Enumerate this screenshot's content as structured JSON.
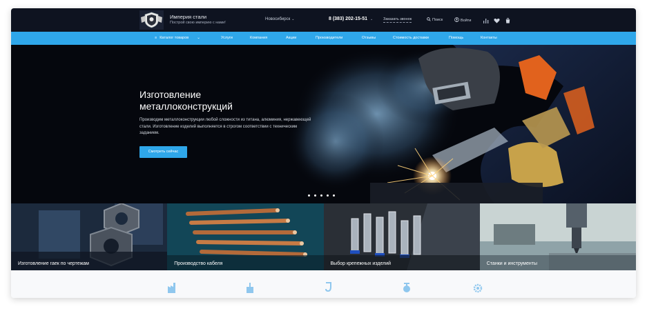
{
  "header": {
    "brand_name": "Империя стали",
    "brand_slogan": "Построй свою империю с нами!",
    "city": "Новосибирск",
    "phone": "8 (383) 202-15-51",
    "callback_link": "Заказать звонок",
    "search_label": "Поиск",
    "login_label": "Войти"
  },
  "nav": {
    "catalog_label": "Каталог товаров",
    "items": [
      "Услуги",
      "Компания",
      "Акции",
      "Производители",
      "Отзывы",
      "Стоимость доставки",
      "Помощь",
      "Контакты"
    ]
  },
  "hero": {
    "title": "Изготовление металлоконструкций",
    "text": "Производим металлоконструкции любой сложности из титана, алюминия, нержавеющей стали. Изготовление изделий выполняется в строгом соответствии с техническим заданием.",
    "button_label": "Смотреть сейчас",
    "slides_count": 5
  },
  "categories": [
    {
      "label": "Изготовление гаек по чертежам"
    },
    {
      "label": "Производство кабеля"
    },
    {
      "label": "Выбор крепежных изделий"
    },
    {
      "label": "Станки и инструменты"
    }
  ],
  "colors": {
    "accent": "#2fa7ea",
    "header_bg": "#0e1320",
    "hero_bg": "#05070d"
  },
  "bottom_icons": [
    "factory-icon",
    "tank-icon",
    "crane-hook-icon",
    "valve-icon",
    "gear-icon"
  ]
}
